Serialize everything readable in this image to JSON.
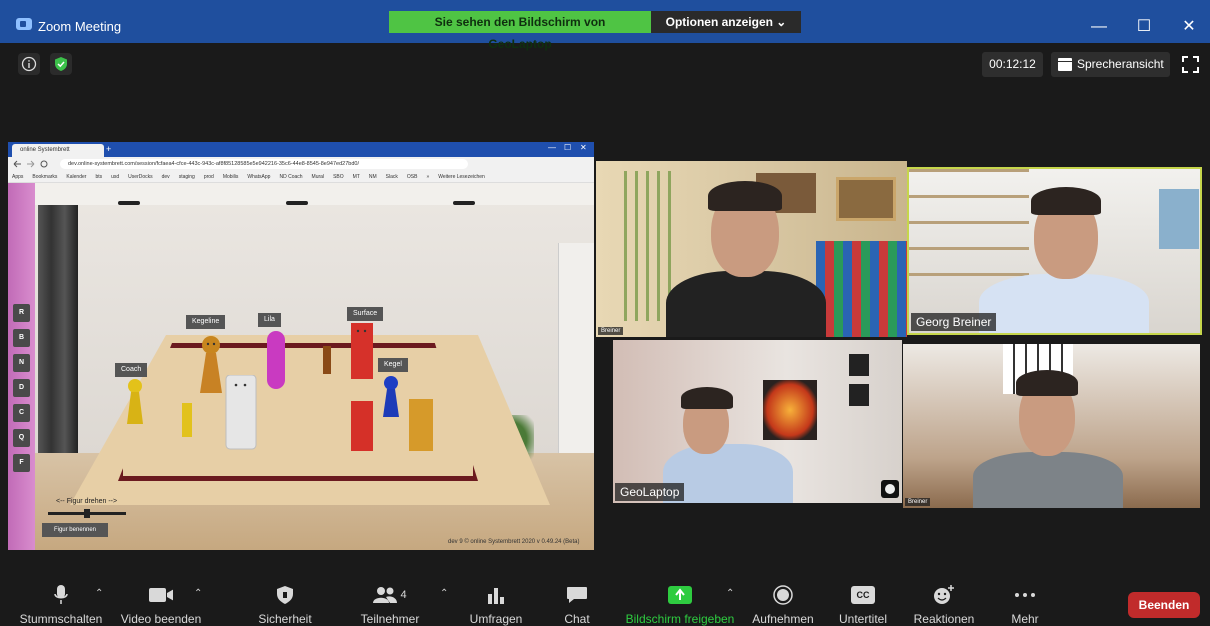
{
  "window": {
    "title": "Zoom Meeting",
    "minimize": "—",
    "maximize": "☐",
    "close": "✕"
  },
  "banner": {
    "sharing_text": "Sie sehen den Bildschirm von GeoLaptop",
    "options_label": "Optionen anzeigen ⌄"
  },
  "topbar": {
    "timer": "00:12:12",
    "view_label": "Sprecheransicht"
  },
  "shared_screen": {
    "tab_title": "online Systembrett",
    "tab_plus": "+",
    "window_controls": [
      "—",
      "☐",
      "✕"
    ],
    "url": "dev.online-systembrett.com/session/fcfaea4-cfce-443c-943c-af8f85128585e5e942216-35c6-44e8-8545-8e947ed27bd0/",
    "bookmarks": [
      "Apps",
      "Bookmarks",
      "Kalender",
      "bts",
      "usd",
      "UserDocks",
      "dev",
      "staging",
      "prod",
      "Mobilis",
      "WhatsApp",
      "ND Coach",
      "Mural",
      "SBO",
      "MT",
      "NM",
      "Slack",
      "OSB",
      "»",
      "Weitere Lesezeichen"
    ],
    "side_buttons": [
      "R",
      "B",
      "N",
      "D",
      "C",
      "Q",
      "F"
    ],
    "pieces": {
      "coach": "Coach",
      "kegeline": "Kegeline",
      "lila": "Lila",
      "surface": "Surface",
      "kegel": "Kegel"
    },
    "turn_label": "<-- Figur drehen -->",
    "name_button": "Figur benennen",
    "version": "dev 9 © online Systembrett 2020 v 0.49.24 (Beta)"
  },
  "participants": [
    {
      "name": "Breiner"
    },
    {
      "name": "Georg Breiner"
    },
    {
      "name": "GeoLaptop"
    },
    {
      "name": "Breiner"
    }
  ],
  "toolbar": {
    "mute": "Stummschalten",
    "video": "Video beenden",
    "security": "Sicherheit",
    "participants": "Teilnehmer",
    "participants_count": "4",
    "polls": "Umfragen",
    "chat": "Chat",
    "share": "Bildschirm freigeben",
    "record": "Aufnehmen",
    "subtitles": "Untertitel",
    "subtitles_icon": "CC",
    "reactions": "Reaktionen",
    "more": "Mehr",
    "end": "Beenden"
  },
  "colors": {
    "titlebar": "#1f4f9e",
    "banner_green": "#4fc444",
    "share_green": "#2ecc40",
    "end_red": "#c12b2b",
    "active_speaker": "#c6d64b"
  }
}
